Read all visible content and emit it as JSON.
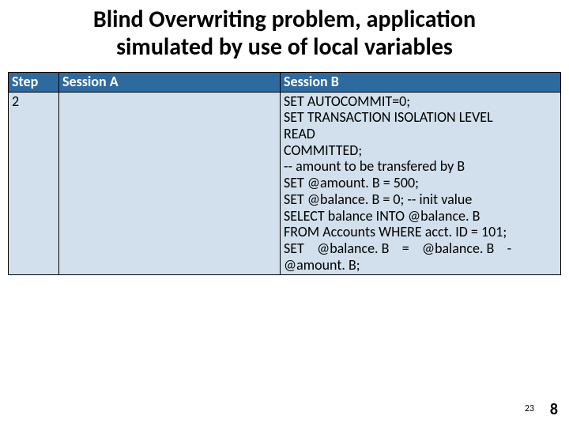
{
  "slide": {
    "title_line1": "Blind Overwriting problem, application",
    "title_line2": "simulated by use of local variables"
  },
  "table": {
    "headers": {
      "step": "Step",
      "sessA": "Session A",
      "sessB": "Session B"
    },
    "row": {
      "step": "2",
      "sessA": "",
      "sessB": {
        "l1": "SET AUTOCOMMIT=0;",
        "l2": "SET TRANSACTION ISOLATION LEVEL",
        "l3": "READ",
        "l4": "COMMITTED;",
        "l5": "-- amount to be transfered by B",
        "l6": "SET @amount. B = 500;",
        "l7": "SET @balance. B = 0; -- init value",
        "l8": "SELECT balance INTO @balance. B",
        "l9": "FROM Accounts WHERE acct. ID = 101;",
        "l10": "SET    @balance. B    =    @balance. B    -",
        "l11": "@amount. B;"
      }
    }
  },
  "footers": {
    "inner": "23",
    "page": "8"
  }
}
